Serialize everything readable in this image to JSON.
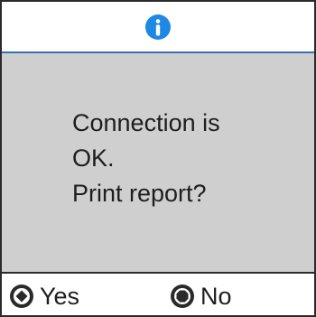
{
  "header": {
    "icon": "info-icon"
  },
  "message": {
    "lines": [
      "Connection is",
      "OK.",
      "Print report?"
    ]
  },
  "footer": {
    "yes": {
      "icon": "start-button-icon",
      "label": "Yes"
    },
    "no": {
      "icon": "stop-button-icon",
      "label": "No"
    }
  },
  "colors": {
    "accent": "#1e88e5",
    "panel": "#cfcfcf",
    "header_line": "#3a6fb4"
  }
}
